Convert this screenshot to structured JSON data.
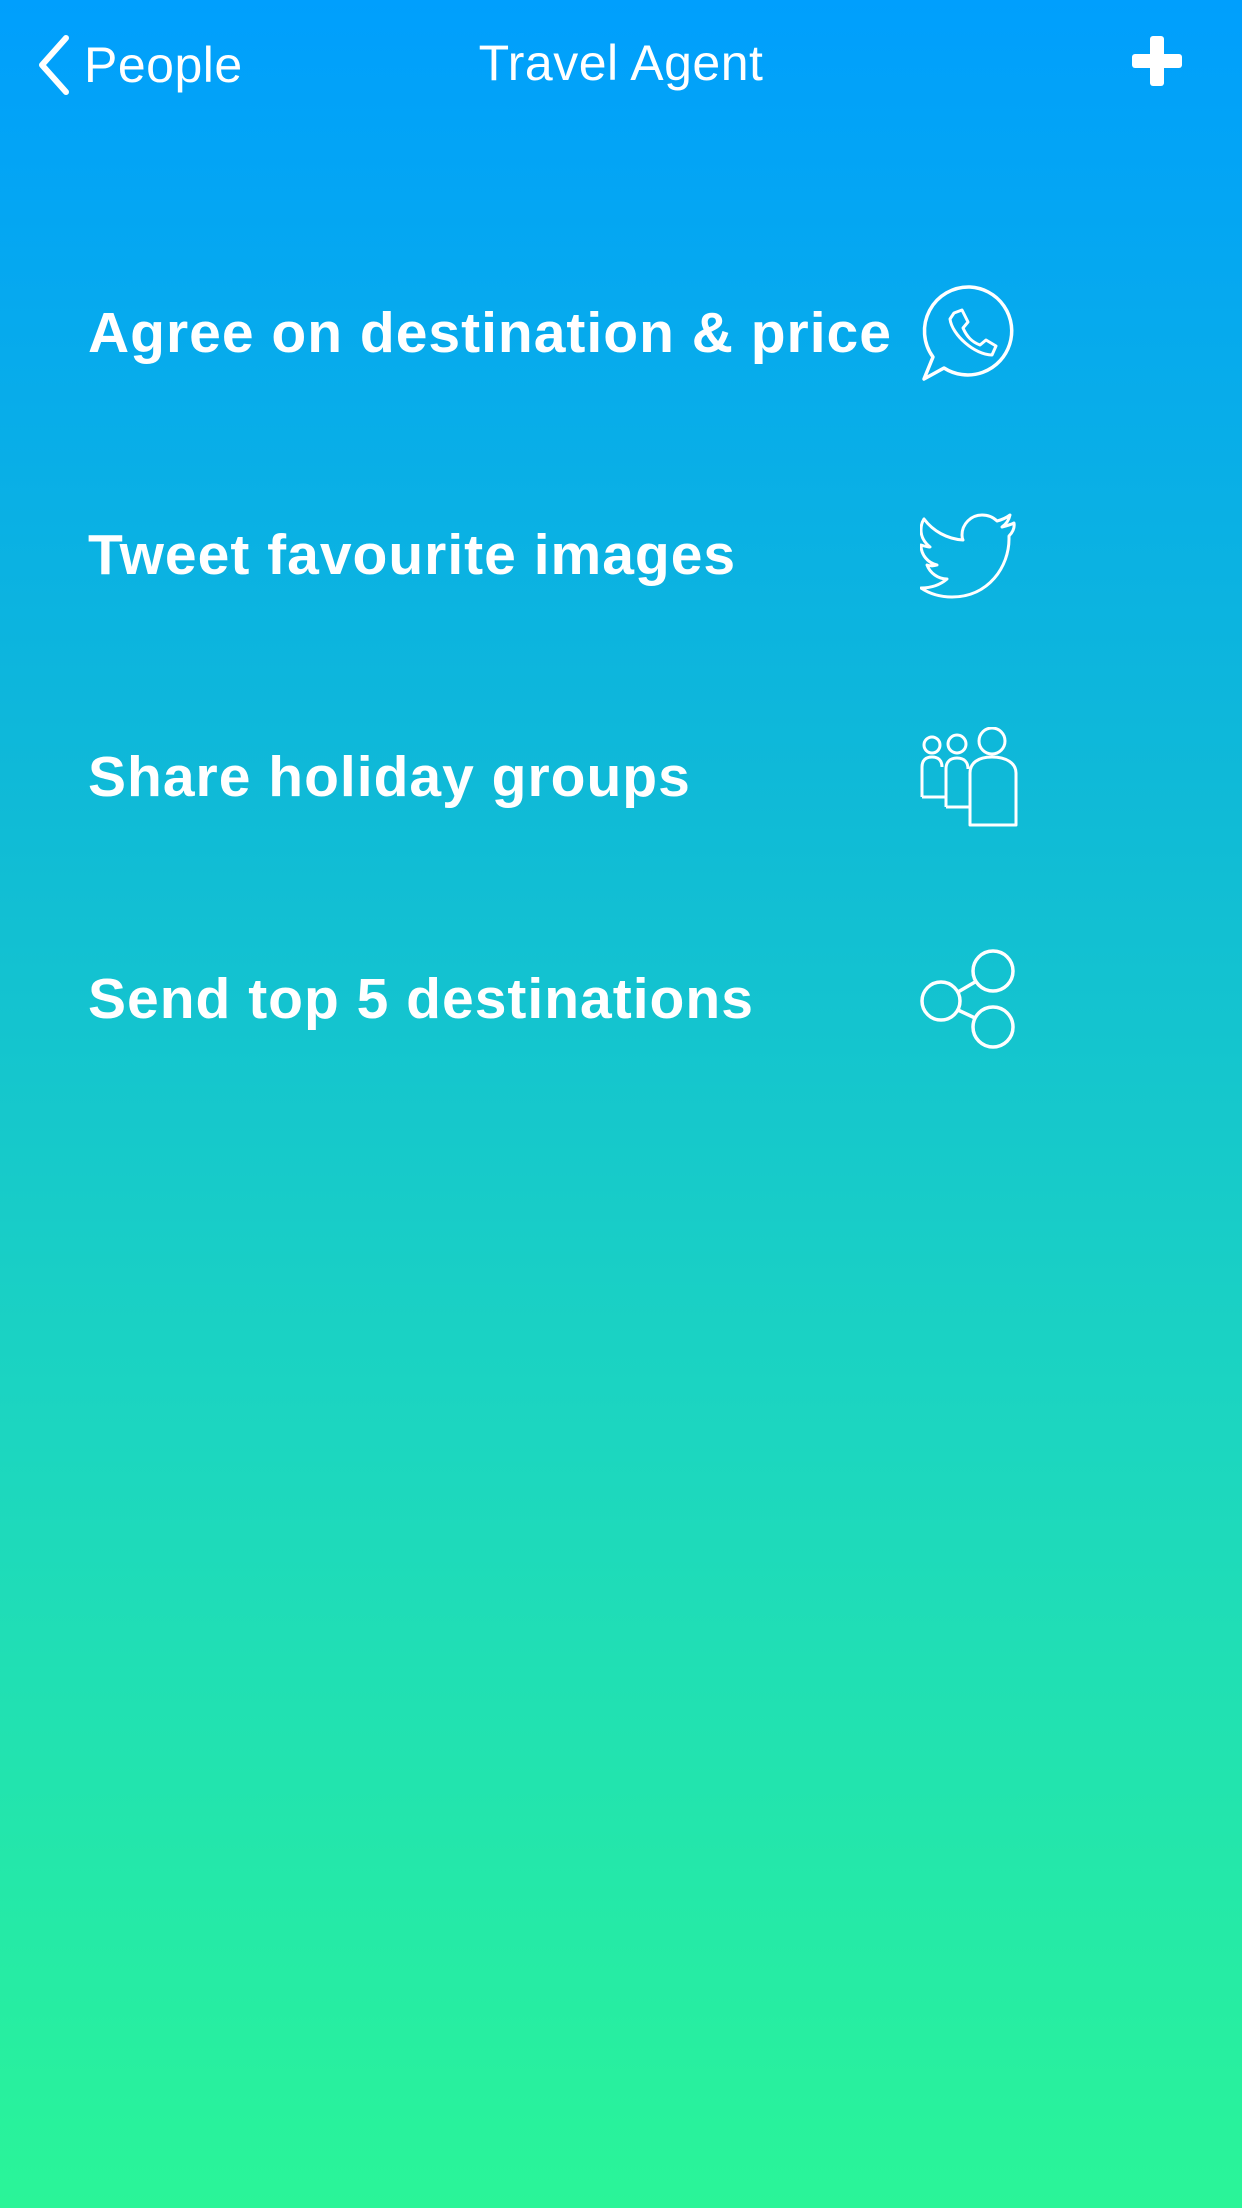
{
  "nav": {
    "back_label": "People",
    "title": "Travel Agent",
    "add_icon": "plus-icon",
    "back_icon": "chevron-left-icon"
  },
  "items": [
    {
      "label": "Agree on destination & price",
      "icon": "whatsapp-icon"
    },
    {
      "label": "Tweet favourite images",
      "icon": "twitter-icon"
    },
    {
      "label": "Share holiday groups",
      "icon": "group-people-icon"
    },
    {
      "label": "Send top 5 destinations",
      "icon": "share-icon"
    }
  ],
  "colors": {
    "gradient_top": "#009ffd",
    "gradient_bottom": "#2af598",
    "foreground": "#ffffff"
  }
}
